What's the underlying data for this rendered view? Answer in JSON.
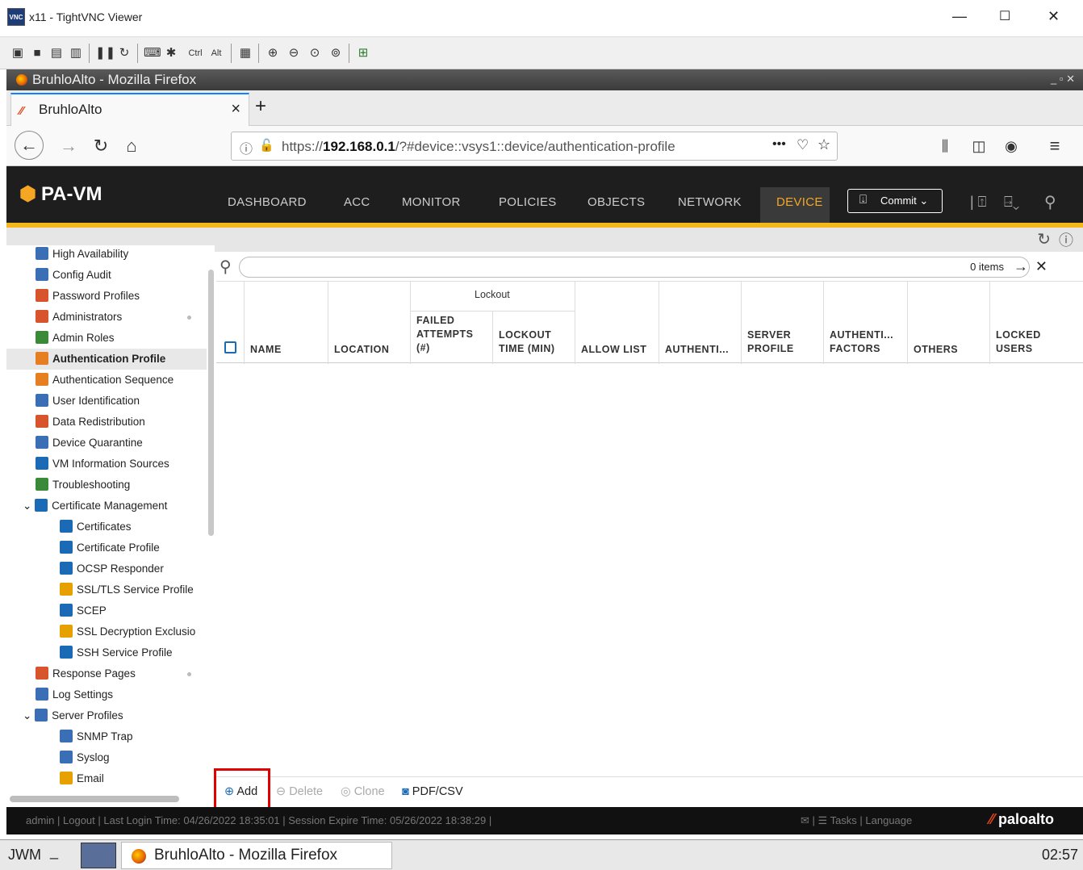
{
  "vnc": {
    "title": "x11 - TightVNC Viewer",
    "logo_text": "VNC",
    "toolbar_ctrl": "Ctrl",
    "toolbar_alt": "Alt"
  },
  "firefox": {
    "window_title": "BruhloAlto - Mozilla Firefox",
    "tab_label": "BruhloAlto",
    "url_prefix": "https://",
    "url_host": "192.168.0.1",
    "url_path": "/?#device::vsys1::device/authentication-profile"
  },
  "pa": {
    "brand": "PA-VM",
    "nav": [
      "DASHBOARD",
      "ACC",
      "MONITOR",
      "POLICIES",
      "OBJECTS",
      "NETWORK",
      "DEVICE"
    ],
    "commit_label": "Commit"
  },
  "sidebar": {
    "items": [
      {
        "label": "High Availability",
        "icon": "ha-icon",
        "color": "#3a6fb5"
      },
      {
        "label": "Config Audit",
        "icon": "config-audit-icon",
        "color": "#3a6fb5"
      },
      {
        "label": "Password Profiles",
        "icon": "password-profiles-icon",
        "color": "#d8542c"
      },
      {
        "label": "Administrators",
        "icon": "administrators-icon",
        "color": "#d8542c"
      },
      {
        "label": "Admin Roles",
        "icon": "admin-roles-icon",
        "color": "#3a8a3a"
      },
      {
        "label": "Authentication Profile",
        "icon": "authentication-profile-icon",
        "color": "#e67e22"
      },
      {
        "label": "Authentication Sequence",
        "icon": "authentication-sequence-icon",
        "color": "#e67e22"
      },
      {
        "label": "User Identification",
        "icon": "user-identification-icon",
        "color": "#3a6fb5"
      },
      {
        "label": "Data Redistribution",
        "icon": "data-redistribution-icon",
        "color": "#d8542c"
      },
      {
        "label": "Device Quarantine",
        "icon": "device-quarantine-icon",
        "color": "#3a6fb5"
      },
      {
        "label": "VM Information Sources",
        "icon": "vm-info-icon",
        "color": "#1b6ab5"
      },
      {
        "label": "Troubleshooting",
        "icon": "troubleshooting-icon",
        "color": "#3a8a3a"
      },
      {
        "label": "Certificate Management",
        "icon": "certificate-management-icon",
        "color": "#1b6ab5"
      },
      {
        "label": "Certificates",
        "icon": "certificates-icon",
        "color": "#1b6ab5"
      },
      {
        "label": "Certificate Profile",
        "icon": "certificate-profile-icon",
        "color": "#1b6ab5"
      },
      {
        "label": "OCSP Responder",
        "icon": "ocsp-icon",
        "color": "#1b6ab5"
      },
      {
        "label": "SSL/TLS Service Profile",
        "icon": "lock-icon",
        "color": "#e6a100"
      },
      {
        "label": "SCEP",
        "icon": "scep-icon",
        "color": "#1b6ab5"
      },
      {
        "label": "SSL Decryption Exclusio",
        "icon": "lock-icon",
        "color": "#e6a100"
      },
      {
        "label": "SSH Service Profile",
        "icon": "ssh-icon",
        "color": "#1b6ab5"
      },
      {
        "label": "Response Pages",
        "icon": "response-pages-icon",
        "color": "#d8542c"
      },
      {
        "label": "Log Settings",
        "icon": "log-settings-icon",
        "color": "#3a6fb5"
      },
      {
        "label": "Server Profiles",
        "icon": "server-profiles-icon",
        "color": "#3a6fb5"
      },
      {
        "label": "SNMP Trap",
        "icon": "snmp-icon",
        "color": "#3a6fb5"
      },
      {
        "label": "Syslog",
        "icon": "syslog-icon",
        "color": "#3a6fb5"
      },
      {
        "label": "Email",
        "icon": "email-icon",
        "color": "#e6a100"
      }
    ]
  },
  "table": {
    "search_count": "0 items",
    "group_header": "Lockout",
    "headers": [
      "NAME",
      "LOCATION",
      "FAILED ATTEMPTS (#)",
      "LOCKOUT TIME (MIN)",
      "ALLOW LIST",
      "AUTHENTI...",
      "SERVER PROFILE",
      "AUTHENTI... FACTORS",
      "OTHERS",
      "LOCKED USERS"
    ]
  },
  "actions": {
    "add": "Add",
    "delete": "Delete",
    "clone": "Clone",
    "pdf": "PDF/CSV"
  },
  "status": {
    "left": "admin | Logout | Last Login Time: 04/26/2022 18:35:01 | Session Expire Time: 05/26/2022 18:38:29 |",
    "tasks": "Tasks",
    "language": "Language",
    "brand": "paloalto"
  },
  "taskbar": {
    "jwm": "JWM",
    "window": "BruhloAlto - Mozilla Firefox",
    "clock": "02:57"
  },
  "colors": {
    "accent": "#f5a623",
    "yellow_bar": "#f5b71a",
    "highlight": "#e00000"
  }
}
